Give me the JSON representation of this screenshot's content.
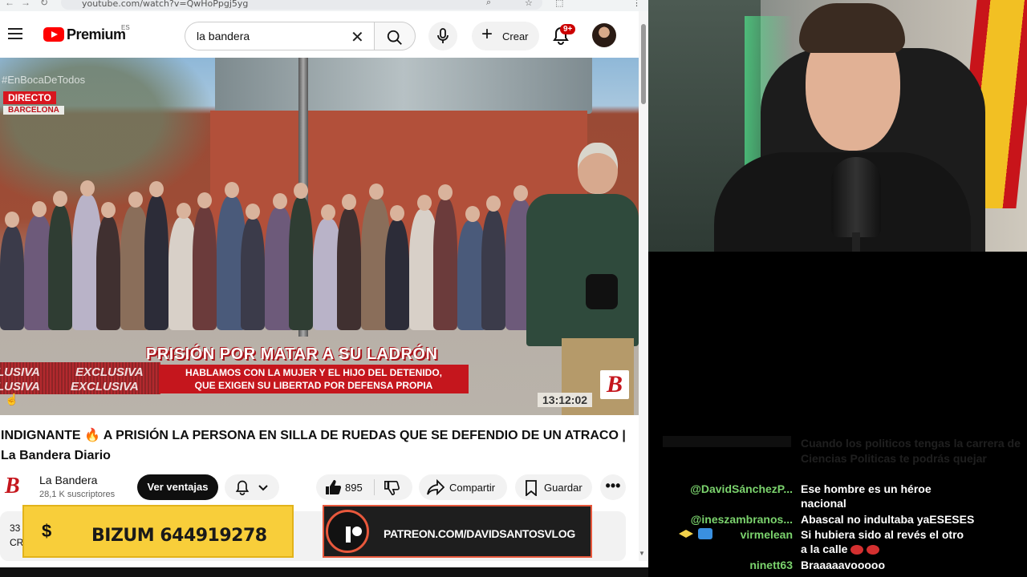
{
  "browser": {
    "url": "youtube.com/watch?v=QwHoPpgj5yg"
  },
  "header": {
    "logo_text": "Premium",
    "region": "ES",
    "search_value": "la bandera",
    "create_label": "Crear",
    "notif_count": "9+"
  },
  "video": {
    "hashtag": "#EnBocaDeTodos",
    "live_label": "DIRECTO",
    "city": "BARCELONA",
    "exclusive_text": "EXCLUSIVA",
    "exclusive_text_partial": "LUSIVA",
    "headline": "PRISIÓN POR MATAR A SU LADRÓN",
    "subline_1": "HABLAMOS CON LA MUJER Y EL HIJO DEL DETENIDO,",
    "subline_2": "QUE EXIGEN SU LIBERTAD POR DEFENSA PROPIA",
    "brand_letter": "B",
    "timestamp": "13:12:02"
  },
  "meta": {
    "title": "INDIGNANTE 🔥 A PRISIÓN LA PERSONA EN SILLA DE RUEDAS QUE SE DEFENDIO DE UN ATRACO | La Bandera Diario",
    "channel_logo": "B",
    "channel_name": "La Bandera",
    "subscribers": "28,1 K suscriptores",
    "join_label": "Ver ventajas",
    "like_count": "895",
    "share_label": "Compartir",
    "save_label": "Guardar",
    "more_label": "•••",
    "desc_views": "33",
    "desc_line2": "CR"
  },
  "overlays": {
    "bizum_symbol": "$",
    "bizum_text": "BIZUM 644919278",
    "patreon_text": "PATREON.COM/DAVIDSANTOSVLOG"
  },
  "chat": {
    "faded_text": "Cuando los politicos tengas la carrera de Ciencias Politicas te podrás quejar",
    "messages": [
      {
        "user": "@DavidSánchezP...",
        "text_1": "Ese hombre es un héroe",
        "text_2": "nacional"
      },
      {
        "user": "@ineszambranos...",
        "text_1": "Abascal no indultaba yaESESES",
        "text_2": ""
      },
      {
        "user": "virmelean",
        "text_1": "Si hubiera sido al revés el otro",
        "text_2": "a la calle"
      },
      {
        "user": "ninett63",
        "text_1": "Braaaaavooooo",
        "text_2": ""
      }
    ]
  },
  "icons": {
    "menu": "hamburger-icon",
    "search": "search-icon",
    "mic": "mic-icon",
    "bell": "bell-icon",
    "like": "thumbs-up-icon",
    "dislike": "thumbs-down-icon",
    "share": "share-icon",
    "save": "bookmark-icon"
  },
  "colors": {
    "youtube_red": "#ff0000",
    "live_red": "#d8161f",
    "chat_username": "#7bd36d",
    "bizum_yellow": "#f8ce3a",
    "patreon_orange": "#e8583c"
  }
}
